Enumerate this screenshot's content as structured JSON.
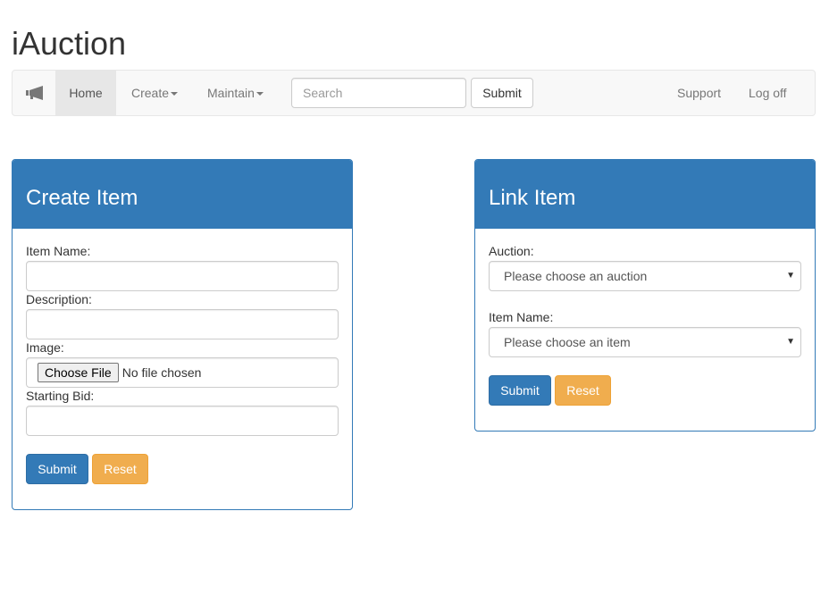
{
  "app": {
    "title": "iAuction"
  },
  "navbar": {
    "brand_icon": "megaphone-icon",
    "home_label": "Home",
    "create_label": "Create",
    "maintain_label": "Maintain",
    "search_placeholder": "Search",
    "search_value": "",
    "submit_label": "Submit",
    "support_label": "Support",
    "logoff_label": "Log off"
  },
  "create_item": {
    "title": "Create Item",
    "item_name_label": "Item Name:",
    "item_name_value": "",
    "description_label": "Description:",
    "description_value": "",
    "image_label": "Image:",
    "choose_file_label": "Choose File",
    "file_status": "No file chosen",
    "starting_bid_label": "Starting Bid:",
    "starting_bid_value": "",
    "submit_label": "Submit",
    "reset_label": "Reset"
  },
  "link_item": {
    "title": "Link Item",
    "auction_label": "Auction:",
    "auction_selected": "Please choose an auction",
    "item_name_label": "Item Name:",
    "item_selected": "Please choose an item",
    "submit_label": "Submit",
    "reset_label": "Reset"
  },
  "colors": {
    "primary": "#337ab7",
    "warning": "#f0ad4e",
    "navbar_bg": "#f8f8f8",
    "active_nav_bg": "#e7e7e7"
  }
}
